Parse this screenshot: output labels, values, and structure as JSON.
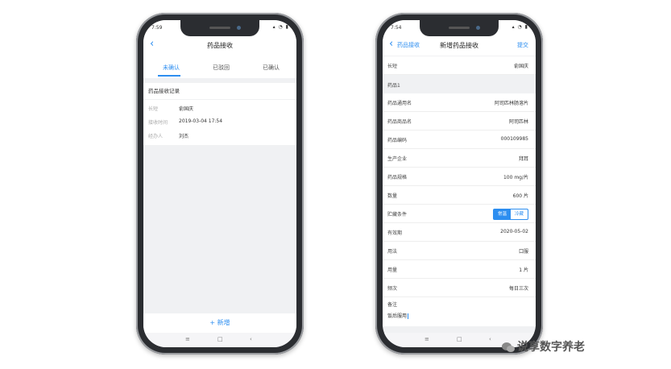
{
  "left_phone": {
    "status_time": "7:59",
    "status_icons": "▴ ◔ ▮",
    "nav_title": "药品接收",
    "tabs": [
      {
        "label": "未确认",
        "active": true
      },
      {
        "label": "已驳回",
        "active": false
      },
      {
        "label": "已确认",
        "active": false
      }
    ],
    "section_title": "药品接收记录",
    "record": {
      "row1_key": "长短",
      "row1_value": "俞国庆",
      "row2_key": "接收时间",
      "row2_value": "2019-03-04 17:54",
      "row3_key": "经办人",
      "row3_value": "刘杰"
    },
    "add_label": "+ 新增",
    "home_bar": [
      "≡",
      "□",
      "‹"
    ]
  },
  "right_phone": {
    "status_time": "7:54",
    "status_icons": "▴ ◔ ▮",
    "back_label": "药品接收",
    "nav_title": "新增药品接收",
    "submit_label": "提交",
    "rows": [
      {
        "label": "长短",
        "value": "俞国庆"
      },
      {
        "label": "药品1",
        "value": "",
        "group": true
      },
      {
        "label": "药品通用名",
        "value": "阿司匹林肠溶片"
      },
      {
        "label": "药品商品名",
        "value": "阿司匹林"
      },
      {
        "label": "药品编码",
        "value": "000109985"
      },
      {
        "label": "生产企业",
        "value": "拜耳"
      },
      {
        "label": "药品规格",
        "value": "100  mg/片"
      },
      {
        "label": "数量",
        "value": "600  片"
      },
      {
        "label": "贮藏条件",
        "value": "",
        "segmented": true
      },
      {
        "label": "有效期",
        "value": "2020-05-02"
      },
      {
        "label": "用法",
        "value": "口服"
      },
      {
        "label": "用量",
        "value": "1  片"
      },
      {
        "label": "频次",
        "value": "每日三次"
      }
    ],
    "storage_options": [
      {
        "label": "常温",
        "selected": true
      },
      {
        "label": "冷藏",
        "selected": false
      }
    ],
    "remark_label": "备注",
    "remark_text": "饭后服用",
    "home_bar": [
      "≡",
      "□",
      "‹"
    ]
  },
  "watermark": "说享数字养老"
}
